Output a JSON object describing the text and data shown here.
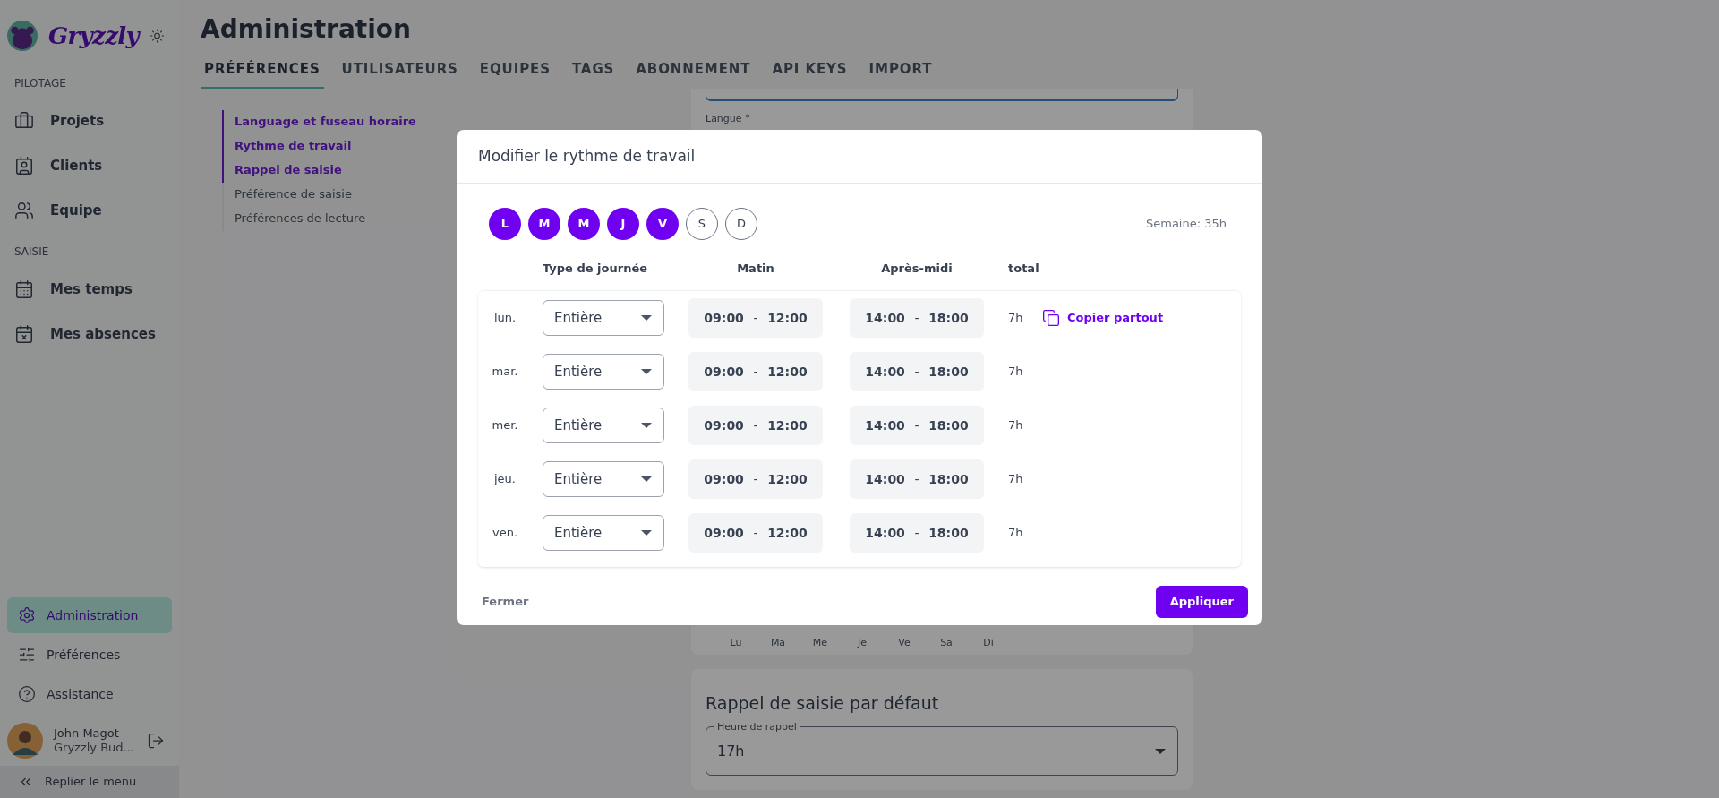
{
  "sidebar": {
    "brand": "Gryzzly",
    "sections": [
      {
        "title": "PILOTAGE",
        "items": [
          {
            "label": "Projets",
            "kind": "briefcase"
          },
          {
            "label": "Clients",
            "kind": "contacts"
          },
          {
            "label": "Equipe",
            "kind": "users"
          }
        ]
      },
      {
        "title": "SAISIE",
        "items": [
          {
            "label": "Mes temps",
            "kind": "calendar"
          },
          {
            "label": "Mes absences",
            "kind": "absence"
          }
        ]
      }
    ],
    "bottom_items": [
      {
        "label": "Administration",
        "kind": "gear",
        "selected": true
      },
      {
        "label": "Préférences",
        "kind": "sliders",
        "selected": false
      },
      {
        "label": "Assistance",
        "kind": "help",
        "selected": false
      }
    ],
    "user": {
      "name": "John Magot",
      "company": "Gryzzly Bud..."
    },
    "collapse": "Replier le menu"
  },
  "page": {
    "title": "Administration",
    "tabs": [
      {
        "label": "PRÉFÉRENCES",
        "selected": true
      },
      {
        "label": "UTILISATEURS",
        "selected": false
      },
      {
        "label": "EQUIPES",
        "selected": false
      },
      {
        "label": "TAGS",
        "selected": false
      },
      {
        "label": "ABONNEMENT",
        "selected": false
      },
      {
        "label": "API KEYS",
        "selected": false
      },
      {
        "label": "IMPORT",
        "selected": false
      }
    ],
    "section_nav": [
      {
        "label": "Language et fuseau horaire",
        "selected": true
      },
      {
        "label": "Rythme de travail",
        "selected": true
      },
      {
        "label": "Rappel de saisie",
        "selected": true
      },
      {
        "label": "Préférence de saisie",
        "selected": false
      },
      {
        "label": "Préférences de lecture",
        "selected": false
      }
    ],
    "language_field": {
      "label": "Langue",
      "required_mark": "*"
    },
    "weekday_labels": [
      "Lu",
      "Ma",
      "Me",
      "Je",
      "Ve",
      "Sa",
      "Di"
    ],
    "reminder_card": {
      "title": "Rappel de saisie par défaut",
      "field": {
        "label": "Heure de rappel",
        "value": "17h"
      }
    }
  },
  "dialog": {
    "title": "Modifier le rythme de travail",
    "days": [
      {
        "label": "L",
        "selected": true
      },
      {
        "label": "M",
        "selected": true
      },
      {
        "label": "M",
        "selected": true
      },
      {
        "label": "J",
        "selected": true
      },
      {
        "label": "V",
        "selected": true
      },
      {
        "label": "S",
        "selected": false
      },
      {
        "label": "D",
        "selected": false
      }
    ],
    "week_total": "Semaine: 35h",
    "columns": [
      "Type de journée",
      "Matin",
      "Après-midi",
      "total"
    ],
    "rows": [
      {
        "day": "lun.",
        "type": "Entière",
        "morning_start": "09:00",
        "morning_end": "12:00",
        "afternoon_start": "14:00",
        "afternoon_end": "18:00",
        "total": "7h",
        "copy_action": "Copier partout"
      },
      {
        "day": "mar.",
        "type": "Entière",
        "morning_start": "09:00",
        "morning_end": "12:00",
        "afternoon_start": "14:00",
        "afternoon_end": "18:00",
        "total": "7h"
      },
      {
        "day": "mer.",
        "type": "Entière",
        "morning_start": "09:00",
        "morning_end": "12:00",
        "afternoon_start": "14:00",
        "afternoon_end": "18:00",
        "total": "7h"
      },
      {
        "day": "jeu.",
        "type": "Entière",
        "morning_start": "09:00",
        "morning_end": "12:00",
        "afternoon_start": "14:00",
        "afternoon_end": "18:00",
        "total": "7h"
      },
      {
        "day": "ven.",
        "type": "Entière",
        "morning_start": "09:00",
        "morning_end": "12:00",
        "afternoon_start": "14:00",
        "afternoon_end": "18:00",
        "total": "7h"
      }
    ],
    "separator": "-",
    "cancel": "Fermer",
    "apply": "Appliquer"
  }
}
